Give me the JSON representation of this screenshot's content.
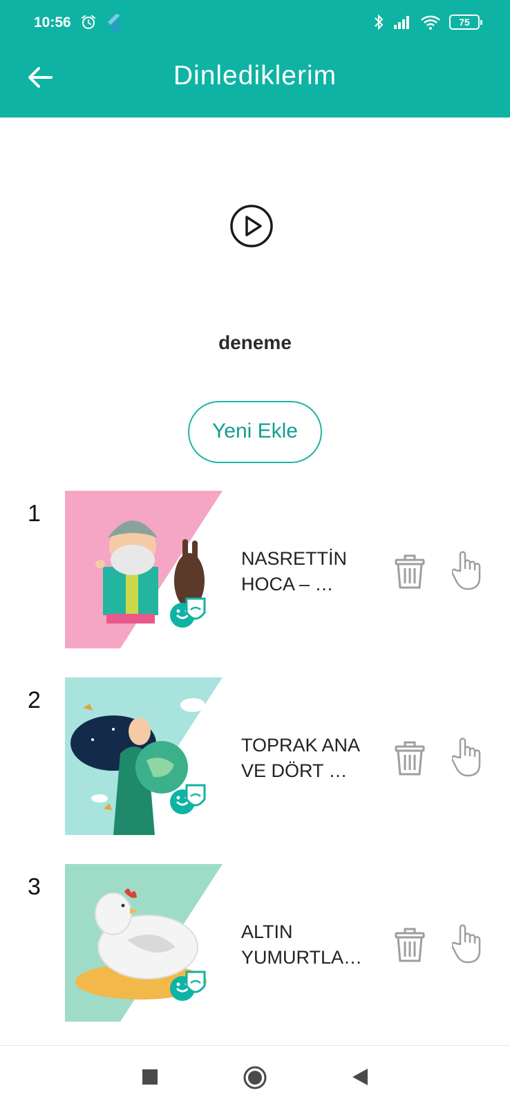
{
  "status": {
    "time": "10:56",
    "battery": "75",
    "icons": [
      "alarm-icon",
      "flutter-icon",
      "bluetooth-icon",
      "signal-icon",
      "wifi-icon",
      "battery-icon"
    ]
  },
  "appbar": {
    "title": "Dinlediklerim",
    "back_icon": "arrow-left-icon"
  },
  "player": {
    "play_icon": "play-circle-icon"
  },
  "list": {
    "title": "deneme",
    "add_label": "Yeni Ekle"
  },
  "items": [
    {
      "index": "1",
      "name": "NASRETTİN\nHOCA – …",
      "thumb": "nasreddin-hoca-cover"
    },
    {
      "index": "2",
      "name": "TOPRAK ANA\nVE DÖRT …",
      "thumb": "toprak-ana-cover"
    },
    {
      "index": "3",
      "name": "ALTIN\nYUMURTLA…",
      "thumb": "altin-yumurta-cover"
    }
  ],
  "colors": {
    "primary": "#0fb3a3",
    "accent_text": "#149d90",
    "icon_gray": "#9e9e9e",
    "thumb1_bg": "#f4a6c4",
    "thumb2_bg": "#a8e4dd",
    "thumb3_bg": "#9fdcc8"
  },
  "navbar": {
    "icons": [
      "recents-square-icon",
      "home-circle-icon",
      "back-triangle-icon"
    ]
  }
}
